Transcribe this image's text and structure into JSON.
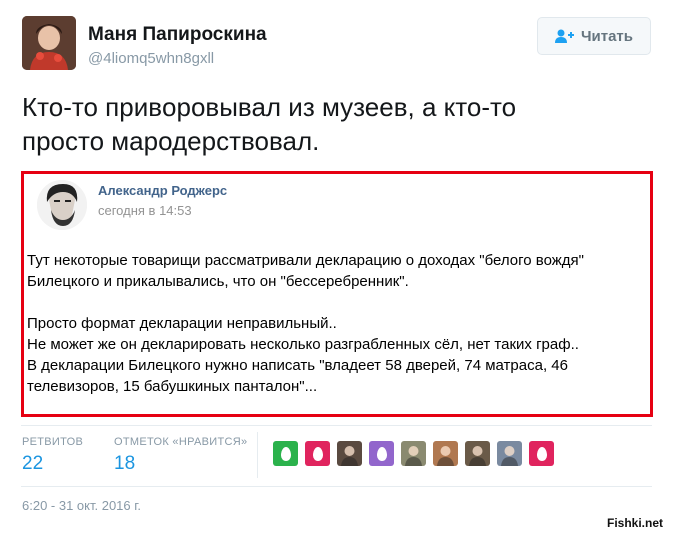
{
  "author": {
    "name": "Маня Папироскина",
    "handle": "@4liomq5whn8gxll"
  },
  "follow_button": {
    "label": "Читать",
    "icon": "person-plus-icon"
  },
  "tweet": {
    "text_line1": "Кто-то привoровывал из музеев, а кто-то",
    "text_line2": "просто мародерствовал."
  },
  "quoted_post": {
    "author": "Александр Роджерс",
    "time": "сегодня в 14:53",
    "paragraph1_line1": "Тут некоторые товарищи рассматривали декларацию о доходах \"белого вождя\"",
    "paragraph1_line2": "Билецкого и прикалывались, что он \"бессеребренник\".",
    "paragraph2_line1": "Просто формат декларации неправильный..",
    "paragraph2_line2": "Не может же он декларировать несколько разграбленных сёл, нет таких граф..",
    "paragraph2_line3": "В декларации Билецкого нужно написать \"владеет 58 дверей, 74 матраса, 46",
    "paragraph2_line4": "телевизоров, 15 бабушкиных панталон\"..."
  },
  "stats": {
    "retweets_label": "РЕТВИТОВ",
    "retweets_value": "22",
    "likes_label": "ОТМЕТОК «НРАВИТСЯ»",
    "likes_value": "18"
  },
  "likers": [
    {
      "type": "egg",
      "color": "#2bb24c"
    },
    {
      "type": "egg",
      "color": "#e0245e"
    },
    {
      "type": "photo",
      "color": "#5a4a40"
    },
    {
      "type": "egg",
      "color": "#9266cc"
    },
    {
      "type": "photo",
      "color": "#8a8a70"
    },
    {
      "type": "photo",
      "color": "#b07850"
    },
    {
      "type": "photo",
      "color": "#6a5a48"
    },
    {
      "type": "photo",
      "color": "#7a8aa0"
    },
    {
      "type": "egg",
      "color": "#e0245e"
    }
  ],
  "timestamp": "6:20 - 31 окт. 2016 г.",
  "watermark": "Fishki.net",
  "colors": {
    "quote_border": "#e60012",
    "link_blue": "#1b95e0",
    "vk_name": "#42648b"
  }
}
